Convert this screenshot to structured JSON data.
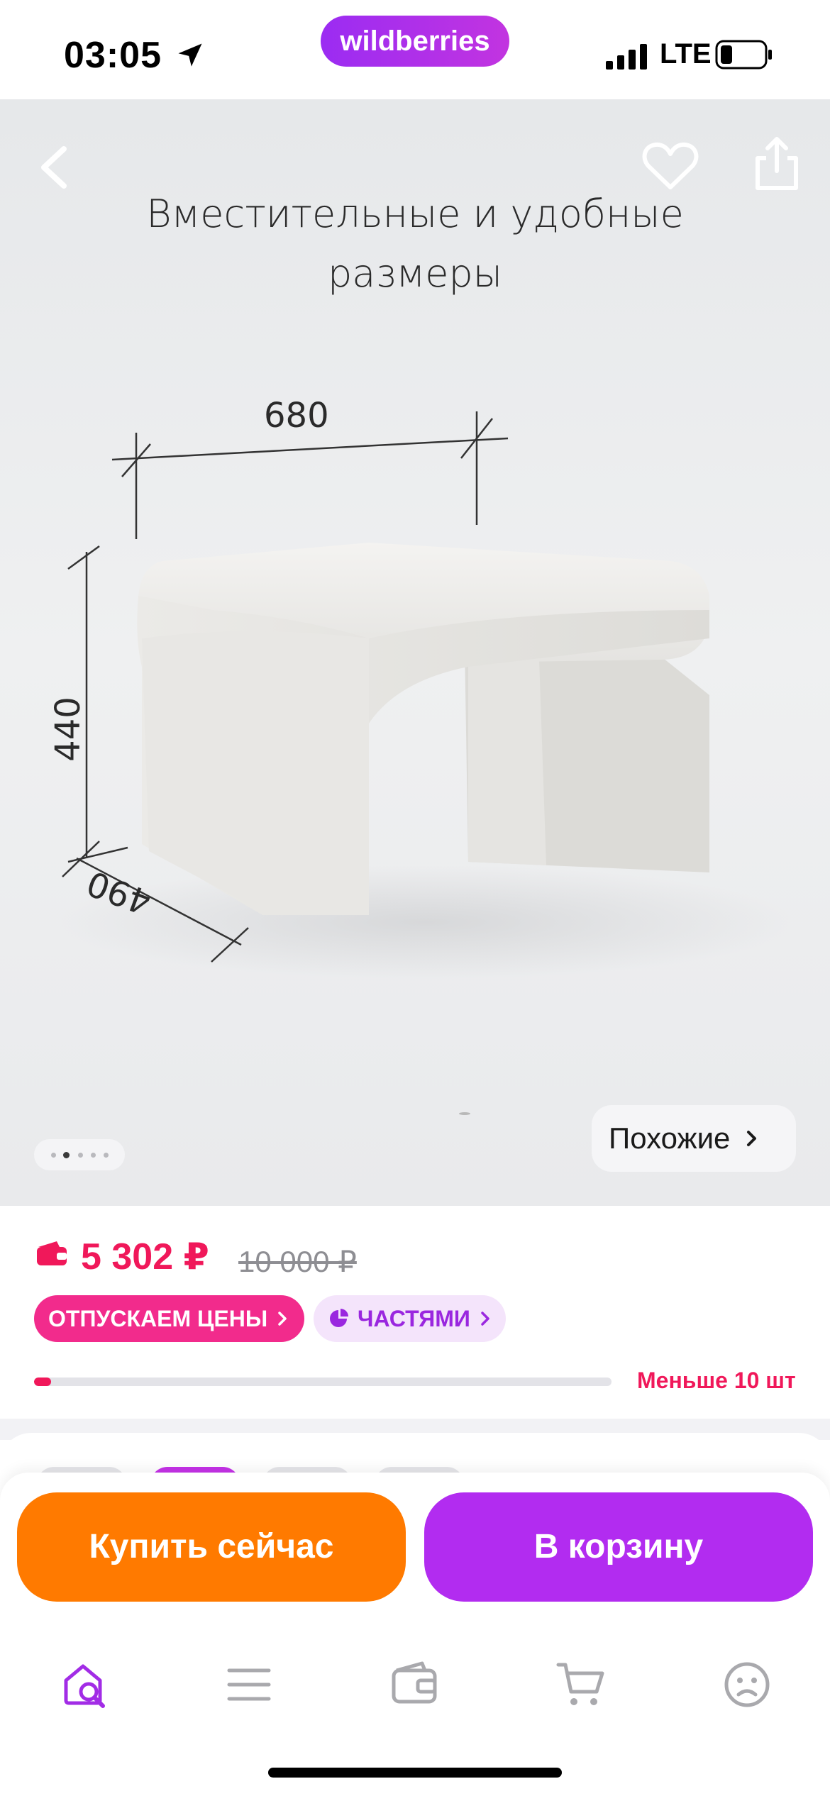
{
  "status_bar": {
    "time": "03:05",
    "brand": "wildberries",
    "network": "LTE",
    "icons": [
      "location-arrow-icon",
      "signal-icon",
      "battery-icon"
    ]
  },
  "gallery": {
    "caption_line1": "Вместительные и удобные",
    "caption_line2": "размеры",
    "dimensions": {
      "width": "680",
      "height": "440",
      "depth": "490"
    },
    "similar_label": "Похожие",
    "pager": {
      "count": 5,
      "active_index": 1
    },
    "icons": [
      "back-chevron-icon",
      "heart-icon",
      "share-icon",
      "chevron-right-icon"
    ]
  },
  "price": {
    "current": "5 302 ₽",
    "old": "10 000 ₽",
    "badges": [
      {
        "label": "ОТПУСКАЕМ ЦЕНЫ"
      },
      {
        "label": "ЧАСТЯМИ"
      }
    ],
    "stock_text": "Меньше 10 шт",
    "stock_level": 0.03,
    "accent_color": "#f0185a"
  },
  "actions": {
    "buy_now": "Купить сейчас",
    "add_to_cart": "В корзину",
    "buy_color": "#ff7a00",
    "cart_color": "#b22cf0"
  },
  "tab_bar": {
    "tabs": [
      {
        "name": "home-search",
        "icon": "home-search-icon",
        "active": true
      },
      {
        "name": "catalog",
        "icon": "menu-icon",
        "active": false
      },
      {
        "name": "wallet",
        "icon": "wallet-icon",
        "active": false
      },
      {
        "name": "cart",
        "icon": "cart-icon",
        "active": false
      },
      {
        "name": "profile",
        "icon": "profile-icon",
        "active": false
      }
    ],
    "active_color": "#a22ce6"
  }
}
